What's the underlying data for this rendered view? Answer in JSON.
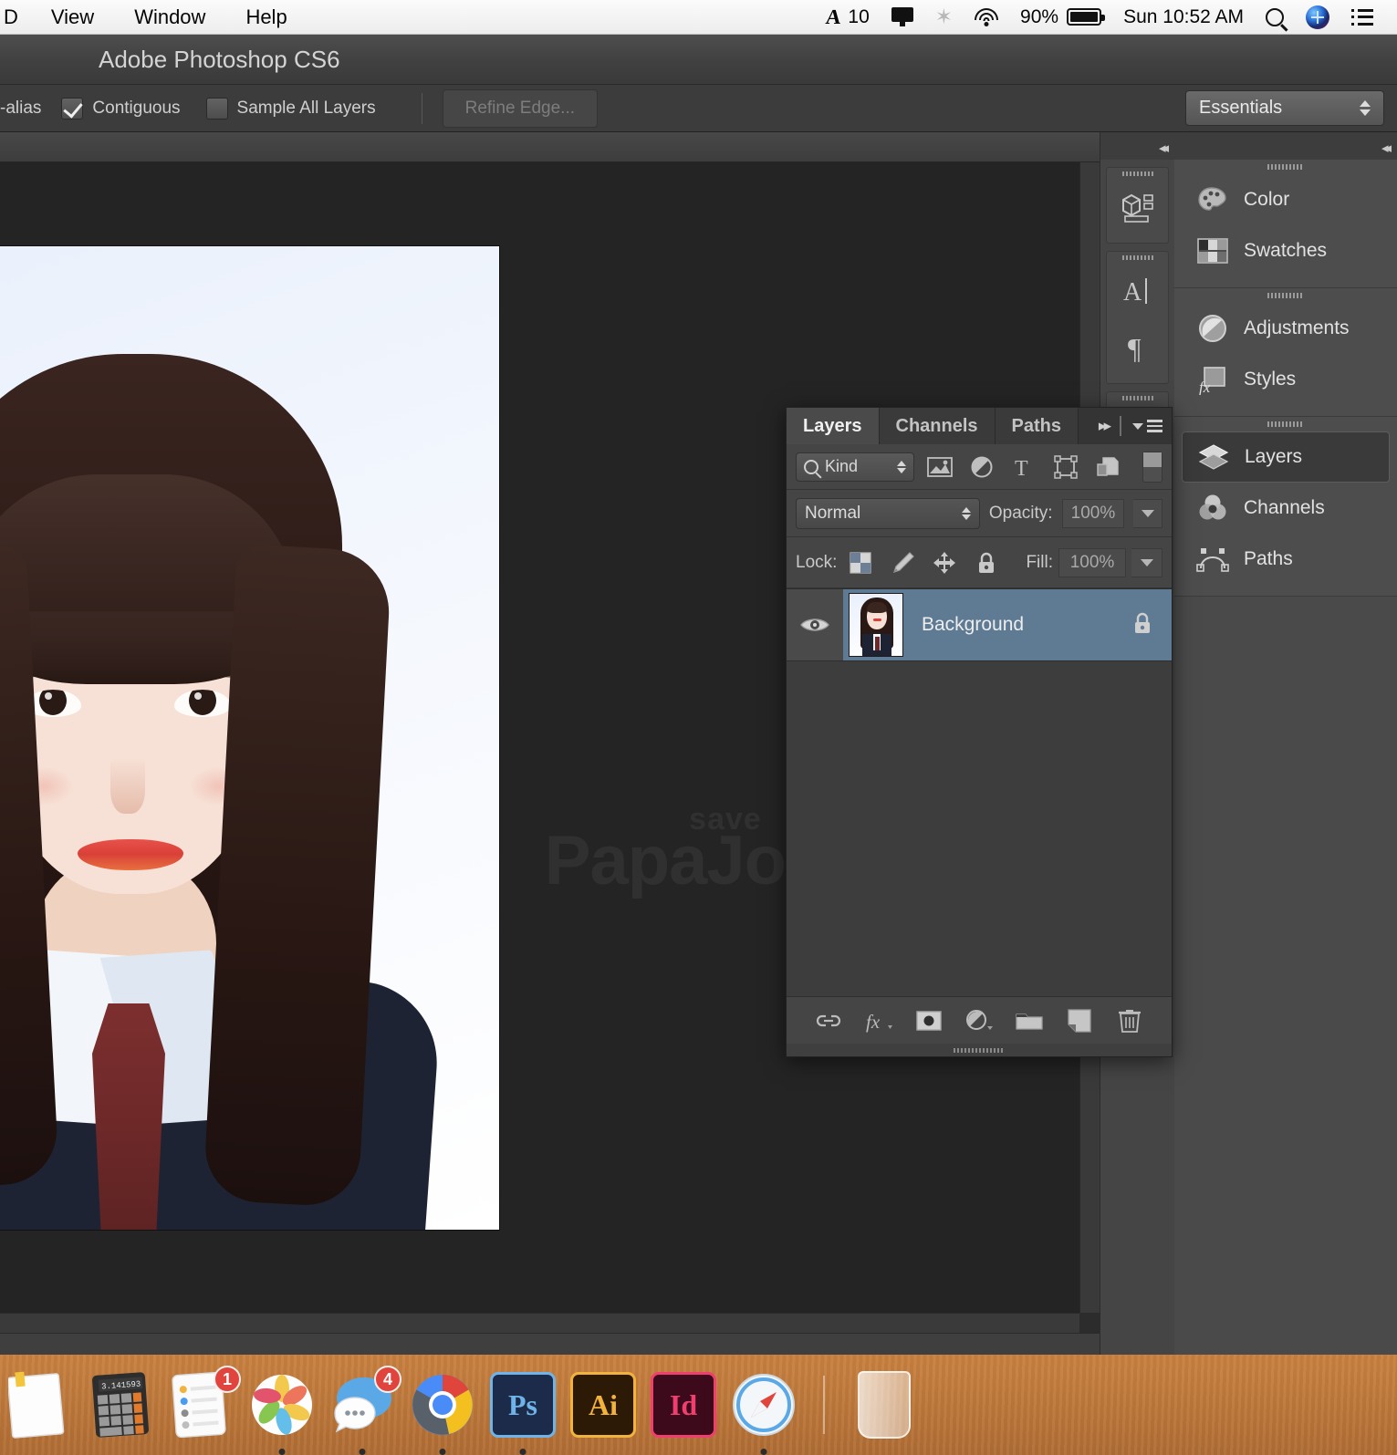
{
  "menubar": {
    "items": [
      {
        "label": "D",
        "clipped": true
      },
      {
        "label": "View"
      },
      {
        "label": "Window"
      },
      {
        "label": "Help"
      }
    ],
    "status": {
      "adobe_icon": "adobe-icon",
      "adobe_count": "10",
      "display_icon": "display-icon",
      "bluetooth_icon": "bluetooth-icon",
      "wifi_icon": "wifi-icon",
      "battery_percent": "90%",
      "battery_icon": "battery-icon",
      "clock": "Sun 10:52 AM",
      "search_icon": "search-icon",
      "siri_icon": "siri-icon",
      "notification_icon": "notification-center-icon"
    }
  },
  "app": {
    "title": "Adobe Photoshop CS6"
  },
  "options_bar": {
    "anti_alias_label": "-alias",
    "contiguous_label": "Contiguous",
    "contiguous_checked": true,
    "sample_all_layers_label": "Sample All Layers",
    "sample_all_layers_checked": false,
    "refine_edge_label": "Refine Edge...",
    "workspace": "Essentials"
  },
  "icon_column": {
    "groups": [
      {
        "icons": [
          {
            "name": "3d-properties-icon"
          }
        ]
      },
      {
        "icons": [
          {
            "name": "character-icon"
          },
          {
            "name": "paragraph-icon"
          }
        ]
      },
      {
        "icons": [
          {
            "name": "timeline-icon"
          }
        ]
      }
    ]
  },
  "dock_panel": {
    "groups": [
      {
        "items": [
          {
            "label": "Color",
            "icon": "color-palette-icon",
            "active": false
          },
          {
            "label": "Swatches",
            "icon": "swatches-grid-icon",
            "active": false
          }
        ]
      },
      {
        "items": [
          {
            "label": "Adjustments",
            "icon": "adjustments-circle-icon",
            "active": false
          },
          {
            "label": "Styles",
            "icon": "styles-fx-icon",
            "active": false
          }
        ]
      },
      {
        "items": [
          {
            "label": "Layers",
            "icon": "layers-stack-icon",
            "active": true
          },
          {
            "label": "Channels",
            "icon": "channels-icon",
            "active": false
          },
          {
            "label": "Paths",
            "icon": "paths-icon",
            "active": false
          }
        ]
      }
    ]
  },
  "layers_panel": {
    "tabs": [
      {
        "label": "Layers",
        "selected": true
      },
      {
        "label": "Channels",
        "selected": false
      },
      {
        "label": "Paths",
        "selected": false
      }
    ],
    "collapse_icon": "collapse-chevrons-icon",
    "menu_icon": "panel-menu-icon",
    "filter": {
      "kind_label": "Kind",
      "search_icon": "search-icon",
      "icons": [
        {
          "name": "filter-pixel-layers-icon"
        },
        {
          "name": "filter-adjustment-layers-icon"
        },
        {
          "name": "filter-type-layers-icon"
        },
        {
          "name": "filter-shape-layers-icon"
        },
        {
          "name": "filter-smart-object-icon"
        }
      ],
      "toggle_icon": "filter-enable-toggle"
    },
    "blend_mode": "Normal",
    "opacity_label": "Opacity:",
    "opacity_value": "100%",
    "lock_label": "Lock:",
    "lock_icons": [
      {
        "name": "lock-transparent-pixels-icon"
      },
      {
        "name": "lock-image-pixels-icon"
      },
      {
        "name": "lock-position-icon"
      },
      {
        "name": "lock-all-icon"
      }
    ],
    "fill_label": "Fill:",
    "fill_value": "100%",
    "layers": [
      {
        "name": "Background",
        "visible": true,
        "locked": true,
        "selected": true,
        "eye_icon": "eye-visibility-icon",
        "lock_icon": "lock-icon",
        "thumbnail": "portrait-thumbnail"
      }
    ],
    "bottom_buttons": [
      {
        "name": "link-layers-icon"
      },
      {
        "name": "layer-style-fx-icon"
      },
      {
        "name": "add-layer-mask-icon"
      },
      {
        "name": "new-adjustment-layer-icon"
      },
      {
        "name": "new-group-icon"
      },
      {
        "name": "new-layer-icon"
      },
      {
        "name": "delete-layer-icon"
      }
    ]
  },
  "canvas": {
    "watermark_small": "save",
    "watermark_big": "PapaJohns",
    "colors": {
      "background": "#eef3fd",
      "skin": "#f7e1d6",
      "hair": "#2a1814",
      "lips": "#d94038",
      "tie": "#6d2828",
      "blazer": "#1d2333",
      "collar": "#f2f5fa"
    }
  },
  "macos_dock": {
    "apps": [
      {
        "name": "pages-icon",
        "label": "Pages",
        "running": false,
        "badge": null
      },
      {
        "name": "calculator-icon",
        "label": "Calculator",
        "running": false,
        "badge": null,
        "display": "3.141593"
      },
      {
        "name": "reminders-icon",
        "label": "Reminders",
        "running": false,
        "badge": "1"
      },
      {
        "name": "photos-icon",
        "label": "Photos",
        "running": true,
        "badge": null
      },
      {
        "name": "messages-icon",
        "label": "Messages",
        "running": true,
        "badge": "4"
      },
      {
        "name": "chrome-icon",
        "label": "Google Chrome",
        "running": true,
        "badge": null
      },
      {
        "name": "photoshop-icon",
        "label": "Ps",
        "running": true,
        "badge": null
      },
      {
        "name": "illustrator-icon",
        "label": "Ai",
        "running": false,
        "badge": null
      },
      {
        "name": "indesign-icon",
        "label": "Id",
        "running": false,
        "badge": null
      },
      {
        "name": "safari-icon",
        "label": "Safari",
        "running": true,
        "badge": null
      }
    ],
    "trash": {
      "name": "trash-icon",
      "label": "Trash"
    }
  }
}
